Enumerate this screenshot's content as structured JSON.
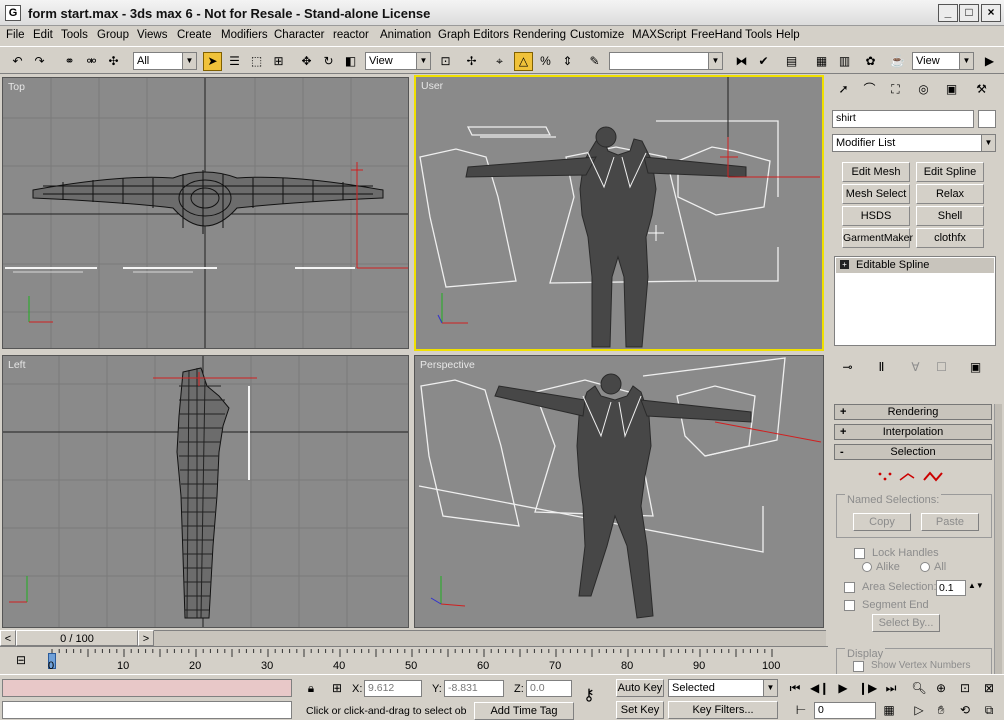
{
  "window": {
    "title": "form start.max - 3ds max 6 - Not for Resale - Stand-alone License",
    "app_icon": "3ds-max-icon",
    "controls": [
      "minimize-icon",
      "maximize-icon",
      "close-icon"
    ]
  },
  "menu": [
    "File",
    "Edit",
    "Tools",
    "Group",
    "Views",
    "Create",
    "Modifiers",
    "Character",
    "reactor",
    "Animation",
    "Graph Editors",
    "Rendering",
    "Customize",
    "MAXScript",
    "FreeHand Tools",
    "Help"
  ],
  "toolbar": {
    "selection_filter": "All",
    "coord_system": "View",
    "named_selection": "",
    "right_dropdown": "View"
  },
  "viewports": {
    "top": "Top",
    "user": "User",
    "left": "Left",
    "perspective": "Perspective"
  },
  "command_panel": {
    "object_name": "shirt",
    "modifier_list": "Modifier List",
    "modifier_buttons": [
      "Edit Mesh",
      "Edit Spline",
      "Mesh Select",
      "Relax",
      "HSDS",
      "Shell",
      "GarmentMaker",
      "clothfx"
    ],
    "stack_item": "Editable Spline",
    "rollouts": {
      "rendering": "Rendering",
      "interpolation": "Interpolation",
      "selection": "Selection"
    },
    "named_selections": {
      "label": "Named Selections:",
      "copy": "Copy",
      "paste": "Paste"
    },
    "lock_handles": "Lock Handles",
    "alike": "Alike",
    "all": "All",
    "area_selection": "Area Selection:",
    "area_value": "0.1",
    "segment_end": "Segment End",
    "select_by": "Select By...",
    "display": "Display",
    "show_vertex_numbers": "Show Vertex Numbers"
  },
  "timeline": {
    "frame_counter": "0 / 100",
    "ticks": [
      "0",
      "10",
      "20",
      "30",
      "40",
      "50",
      "60",
      "70",
      "80",
      "90",
      "100"
    ]
  },
  "status": {
    "x_label": "X:",
    "x_value": "9.612",
    "y_label": "Y:",
    "y_value": "-8.831",
    "z_label": "Z:",
    "z_value": "0.0",
    "prompt": "Click or click-and-drag to select ob",
    "add_time_tag": "Add Time Tag",
    "auto_key": "Auto Key",
    "set_key": "Set Key",
    "key_mode": "Selected",
    "key_filters": "Key Filters...",
    "current_frame": "0"
  },
  "colors": {
    "ui_gray": "#d4d0c8",
    "viewport_bg": "#8a8a8a",
    "active_viewport": "#f0e000",
    "rollout_bg": "#c8c4bc",
    "axis_red": "#d02020",
    "axis_green": "#20b020",
    "axis_blue": "#3030d0"
  }
}
